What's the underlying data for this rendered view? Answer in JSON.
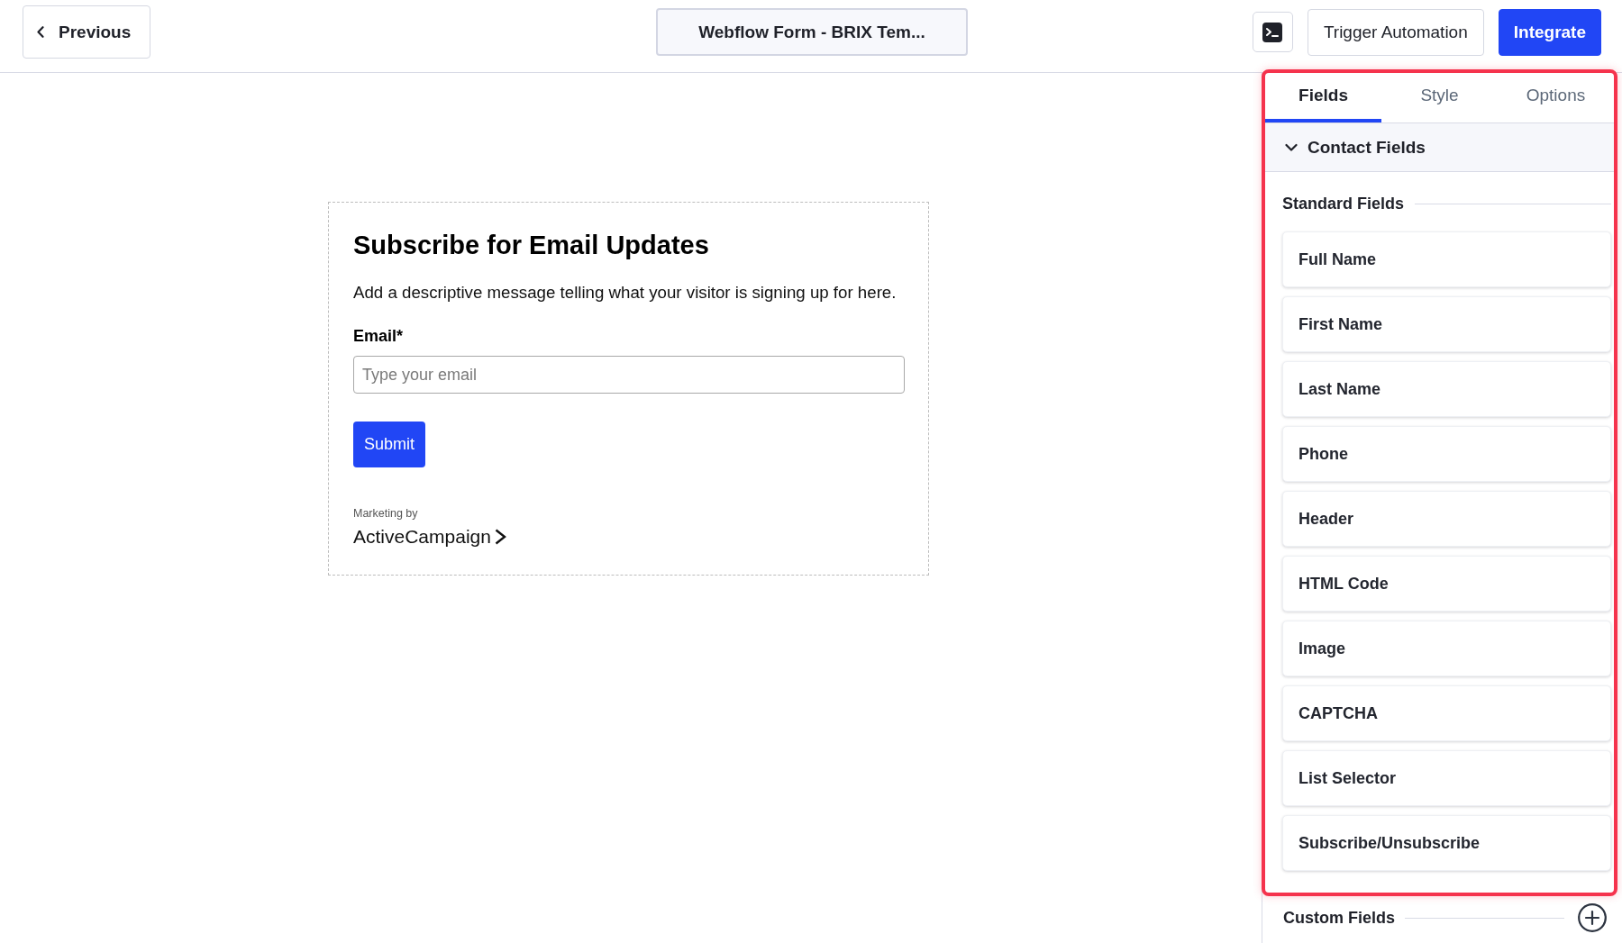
{
  "top_bar": {
    "back_button": "Previous",
    "form_name": "Webflow Form - BRIX Tem...",
    "actions": [
      {
        "kind": "icon"
      },
      {
        "kind": "secondary",
        "label": "Trigger Automation"
      },
      {
        "kind": "primary",
        "label": "Integrate"
      }
    ]
  },
  "form_preview": {
    "title": "Subscribe for Email Updates",
    "description": "Add a descriptive message telling what your visitor is signing up for here.",
    "fields": [
      {
        "label": "Email*",
        "placeholder": "Type your email"
      }
    ],
    "submit_button": "Submit",
    "branding": {
      "caption": "Marketing by",
      "brand": "ActiveCampaign"
    }
  },
  "sidebar": {
    "highlighted": true,
    "tabs": [
      {
        "label": "Fields",
        "selected": true
      },
      {
        "label": "Style",
        "selected": false
      },
      {
        "label": "Options",
        "selected": false
      }
    ],
    "sections": [
      {
        "title": "Contact Fields",
        "expanded": true,
        "groups": [
          {
            "title": "Standard Fields",
            "items": [
              "Full Name",
              "First Name",
              "Last Name",
              "Phone",
              "Header",
              "HTML Code",
              "Image",
              "CAPTCHA",
              "List Selector",
              "Subscribe/Unsubscribe"
            ]
          }
        ]
      }
    ],
    "custom_fields": {
      "title": "Custom Fields"
    }
  }
}
